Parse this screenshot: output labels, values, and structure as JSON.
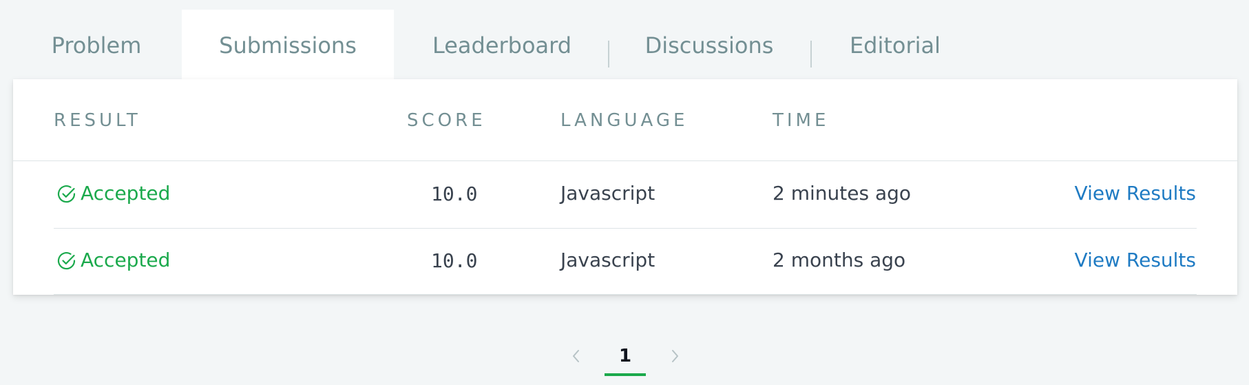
{
  "tabs": [
    {
      "label": "Problem"
    },
    {
      "label": "Submissions",
      "active": true
    },
    {
      "label": "Leaderboard"
    },
    {
      "label": "Discussions"
    },
    {
      "label": "Editorial"
    }
  ],
  "table": {
    "headers": {
      "result": "RESULT",
      "score": "SCORE",
      "language": "LANGUAGE",
      "time": "TIME"
    },
    "rows": [
      {
        "result": "Accepted",
        "score": "10.0",
        "language": "Javascript",
        "time": "2 minutes ago",
        "action": "View Results"
      },
      {
        "result": "Accepted",
        "score": "10.0",
        "language": "Javascript",
        "time": "2 months ago",
        "action": "View Results"
      }
    ]
  },
  "pagination": {
    "current_page": "1",
    "prev_icon": "chevron-left-icon",
    "next_icon": "chevron-right-icon"
  },
  "colors": {
    "accepted": "#1ba94c",
    "link": "#1f7bc3",
    "muted": "#738f93",
    "text": "#39424e",
    "background": "#f3f6f7"
  }
}
